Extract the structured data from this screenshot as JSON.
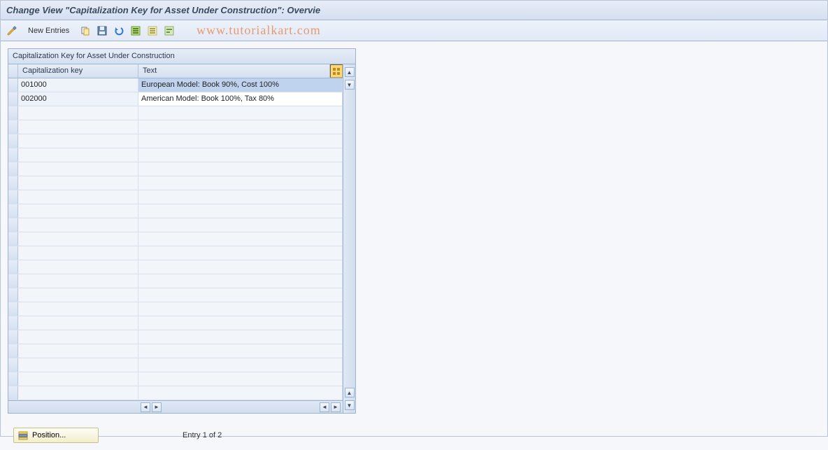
{
  "title": "Change View \"Capitalization Key for Asset Under Construction\": Overvie",
  "toolbar": {
    "new_entries_label": "New Entries",
    "icons": {
      "toggle": "toggle-edit-icon",
      "copy": "copy-icon",
      "save": "save-icon",
      "undo": "undo-icon",
      "select_all": "select-all-icon",
      "deselect_all": "deselect-all-icon",
      "selection": "selection-icon"
    }
  },
  "watermark": "www.tutorialkart.com",
  "table": {
    "title": "Capitalization Key for Asset Under Construction",
    "columns": {
      "key": "Capitalization key",
      "text": "Text"
    },
    "rows": [
      {
        "key": "001000",
        "text": "European Model: Book 90%, Cost 100%",
        "selected": true
      },
      {
        "key": "002000",
        "text": "American Model: Book 100%, Tax 80%",
        "selected": false
      }
    ],
    "empty_row_count": 21
  },
  "footer": {
    "position_label": "Position...",
    "entry_counter": "Entry 1 of 2"
  }
}
